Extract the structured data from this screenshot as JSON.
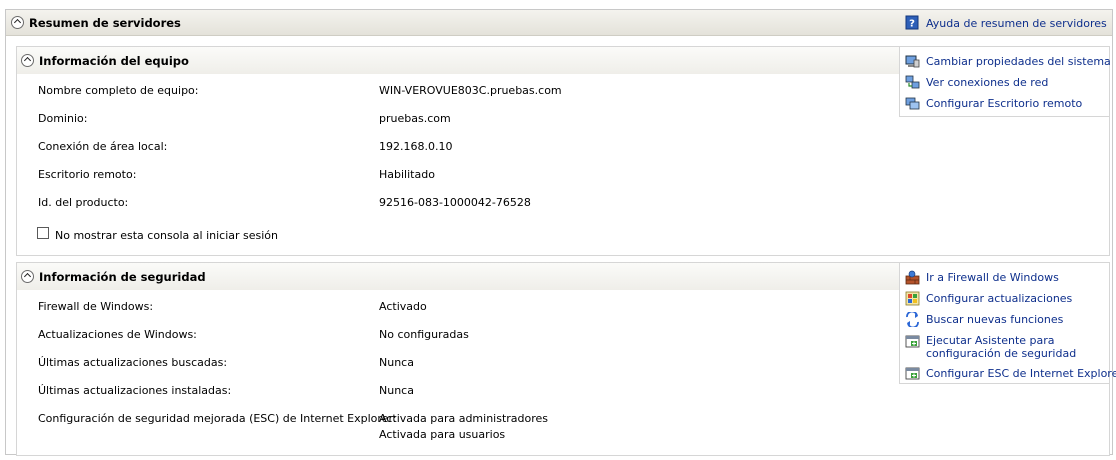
{
  "header": {
    "title": "Resumen de servidores",
    "help_link": "Ayuda de resumen de servidores"
  },
  "computer_info": {
    "title": "Información del equipo",
    "rows": [
      {
        "label": "Nombre completo de equipo:",
        "value": "WIN-VEROVUE803C.pruebas.com"
      },
      {
        "label": "Dominio:",
        "value": "pruebas.com"
      },
      {
        "label": "Conexión de área local:",
        "value": "192.168.0.10"
      },
      {
        "label": "Escritorio remoto:",
        "value": "Habilitado"
      },
      {
        "label": "Id. del producto:",
        "value": "92516-083-1000042-76528"
      }
    ],
    "checkbox_label": "No mostrar esta consola al iniciar sesión",
    "tasks": [
      {
        "label": "Cambiar propiedades del sistema",
        "icon": "system-properties-icon"
      },
      {
        "label": "Ver conexiones de red",
        "icon": "network-connections-icon"
      },
      {
        "label": "Configurar Escritorio remoto",
        "icon": "remote-desktop-icon"
      }
    ]
  },
  "security_info": {
    "title": "Información de seguridad",
    "rows": [
      {
        "label": "Firewall de Windows:",
        "value": "Activado"
      },
      {
        "label": "Actualizaciones de Windows:",
        "value": "No configuradas"
      },
      {
        "label": "Últimas actualizaciones buscadas:",
        "value": "Nunca"
      },
      {
        "label": "Últimas actualizaciones instaladas:",
        "value": "Nunca"
      },
      {
        "label": "Configuración de seguridad mejorada (ESC) de Internet Explorer:",
        "value": "Activada para administradores",
        "value2": "Activada para usuarios"
      }
    ],
    "tasks": [
      {
        "label": "Ir a Firewall de Windows",
        "icon": "firewall-icon"
      },
      {
        "label": "Configurar actualizaciones",
        "icon": "windows-update-icon"
      },
      {
        "label": "Buscar nuevas funciones",
        "icon": "search-features-icon"
      },
      {
        "label": "Ejecutar Asistente para",
        "label2": "configuración de seguridad",
        "icon": "security-wizard-icon"
      },
      {
        "label": "Configurar ESC de Internet Explorer",
        "icon": "ie-esc-icon"
      }
    ]
  },
  "colors": {
    "link": "#0e2f8c",
    "header_gradient_top": "#f4f3ee",
    "header_gradient_bottom": "#e4e2da",
    "border": "#c8c8c8"
  }
}
